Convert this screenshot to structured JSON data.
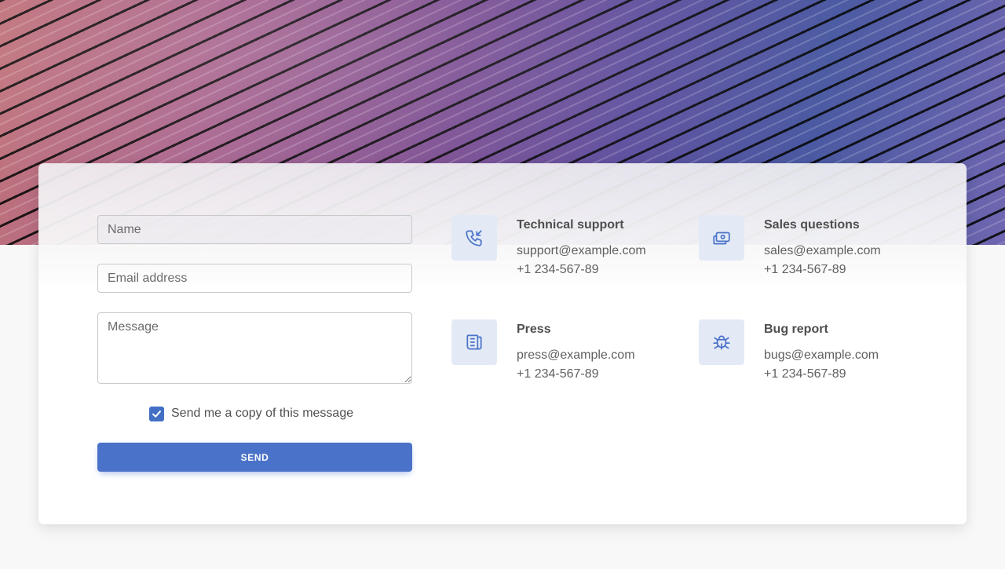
{
  "form": {
    "name_placeholder": "Name",
    "email_placeholder": "Email address",
    "message_placeholder": "Message",
    "copy_label": "Send me a copy of this message",
    "copy_checked": true,
    "send_label": "SEND"
  },
  "contacts": [
    {
      "title": "Technical support",
      "email": "support@example.com",
      "phone": "+1 234-567-89",
      "icon": "phone-incoming-icon"
    },
    {
      "title": "Sales questions",
      "email": "sales@example.com",
      "phone": "+1 234-567-89",
      "icon": "cash-icon"
    },
    {
      "title": "Press",
      "email": "press@example.com",
      "phone": "+1 234-567-89",
      "icon": "newspaper-icon"
    },
    {
      "title": "Bug report",
      "email": "bugs@example.com",
      "phone": "+1 234-567-89",
      "icon": "bug-icon"
    }
  ],
  "colors": {
    "accent": "#4a72c8",
    "icon_bg": "#e3eaf6",
    "text": "#4f4f4f"
  }
}
